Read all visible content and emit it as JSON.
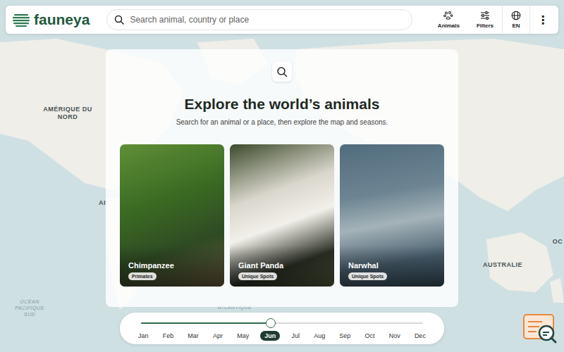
{
  "header": {
    "logo": "fauneya",
    "search_placeholder": "Search animal, country or place",
    "nav": [
      {
        "label": "Animals",
        "kind": "animals"
      },
      {
        "label": "Filters",
        "kind": "filters"
      },
      {
        "label": "EN",
        "kind": "language"
      }
    ],
    "menu": "⋮"
  },
  "map": {
    "labels": [
      {
        "text": "AMÉRIQUE DU NORD",
        "kind": "continent"
      },
      {
        "text": "AI",
        "kind": "continent"
      },
      {
        "text": "AUSTRALIE",
        "kind": "continent"
      },
      {
        "text": "OC",
        "kind": "continent"
      },
      {
        "text": "OCÉAN PACIFIQUE SUD",
        "kind": "ocean"
      },
      {
        "text": "ATLANTIQUE",
        "kind": "ocean"
      }
    ]
  },
  "hero": {
    "title": "Explore the world’s animals",
    "subtitle": "Search for an animal or a place, then explore the map and seasons."
  },
  "cards": [
    {
      "name": "Chimpanzee",
      "tag": "Primates"
    },
    {
      "name": "Giant Panda",
      "tag": "Unique Spots"
    },
    {
      "name": "Narwhal",
      "tag": "Unique Spots"
    }
  ],
  "timeline": {
    "level": 0.46,
    "months": [
      {
        "label": "Jan",
        "selected": false
      },
      {
        "label": "Feb",
        "selected": false
      },
      {
        "label": "Mar",
        "selected": false
      },
      {
        "label": "Apr",
        "selected": false
      },
      {
        "label": "May",
        "selected": false
      },
      {
        "label": "Jun",
        "selected": true
      },
      {
        "label": "Jul",
        "selected": false
      },
      {
        "label": "Aug",
        "selected": false
      },
      {
        "label": "Sep",
        "selected": false
      },
      {
        "label": "Oct",
        "selected": false
      },
      {
        "label": "Nov",
        "selected": false
      },
      {
        "label": "Dec",
        "selected": false
      }
    ]
  }
}
